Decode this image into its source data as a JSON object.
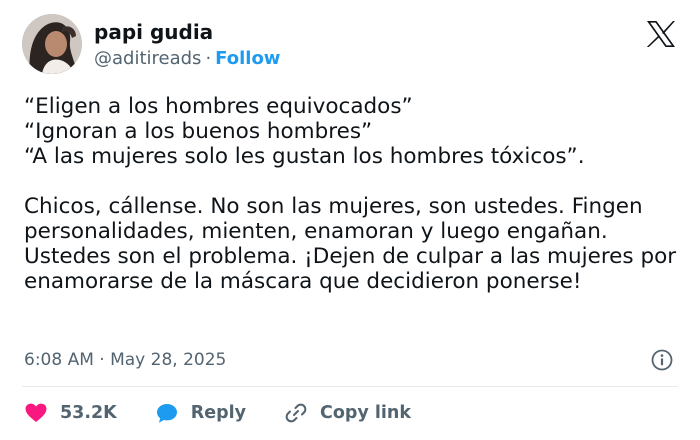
{
  "author": {
    "display_name": "papi gudia",
    "handle": "@aditireads",
    "follow_label": "Follow",
    "separator": "·"
  },
  "tweet": {
    "text": "“Eligen a los hombres equivocados”\n“Ignoran a los buenos hombres”\n“A las mujeres solo les gustan los hombres tóxicos”.\n\nChicos, cállense. No son las mujeres, son ustedes. Fingen personalidades, mienten, enamoran y luego engañan. Ustedes son el problema. ¡Dejen de culpar a las mujeres por enamorarse de la máscara que decidieron ponerse!",
    "timestamp": "6:08 AM · May 28, 2025"
  },
  "actions": {
    "likes": "53.2K",
    "reply_label": "Reply",
    "copy_link_label": "Copy link"
  },
  "icons": {
    "logo": "x-logo-icon",
    "info": "info-icon",
    "like": "heart-icon",
    "reply": "speech-bubble-icon",
    "copy": "link-icon"
  },
  "colors": {
    "text": "#0f1419",
    "secondary": "#536471",
    "accent": "#1d9bf0",
    "like": "#f91880",
    "divider": "#e6ecf0"
  }
}
